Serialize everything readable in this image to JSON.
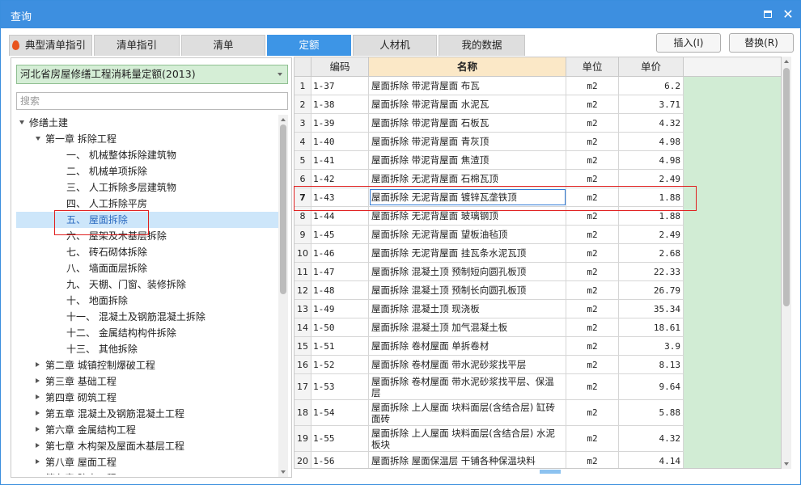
{
  "window": {
    "title": "查询"
  },
  "tabs": [
    {
      "label": "典型清单指引",
      "active": false
    },
    {
      "label": "清单指引",
      "active": false
    },
    {
      "label": "清单",
      "active": false
    },
    {
      "label": "定额",
      "active": true
    },
    {
      "label": "人材机",
      "active": false
    },
    {
      "label": "我的数据",
      "active": false
    }
  ],
  "buttons": {
    "insert": "插入(I)",
    "replace": "替换(R)"
  },
  "left": {
    "library": "河北省房屋修缮工程消耗量定额(2013)",
    "search_placeholder": "搜索",
    "tree": [
      {
        "label": "修缮土建",
        "level": 0,
        "expander": "down"
      },
      {
        "label": "第一章 拆除工程",
        "level": 1,
        "expander": "down"
      },
      {
        "label": "一、 机械整体拆除建筑物",
        "level": 2,
        "expander": ""
      },
      {
        "label": "二、 机械单项拆除",
        "level": 2,
        "expander": ""
      },
      {
        "label": "三、 人工拆除多层建筑物",
        "level": 2,
        "expander": ""
      },
      {
        "label": "四、 人工拆除平房",
        "level": 2,
        "expander": ""
      },
      {
        "label": "五、 屋面拆除",
        "level": 2,
        "expander": "",
        "selected": true
      },
      {
        "label": "六、 屋架及木基层拆除",
        "level": 2,
        "expander": ""
      },
      {
        "label": "七、 砖石砌体拆除",
        "level": 2,
        "expander": ""
      },
      {
        "label": "八、 墙面面层拆除",
        "level": 2,
        "expander": ""
      },
      {
        "label": "九、 天棚、门窗、装修拆除",
        "level": 2,
        "expander": ""
      },
      {
        "label": "十、 地面拆除",
        "level": 2,
        "expander": ""
      },
      {
        "label": "十一、 混凝土及钢筋混凝土拆除",
        "level": 2,
        "expander": ""
      },
      {
        "label": "十二、 金属结构构件拆除",
        "level": 2,
        "expander": ""
      },
      {
        "label": "十三、 其他拆除",
        "level": 2,
        "expander": ""
      },
      {
        "label": "第二章 城镇控制爆破工程",
        "level": 1,
        "expander": "right"
      },
      {
        "label": "第三章 基础工程",
        "level": 1,
        "expander": "right"
      },
      {
        "label": "第四章 砌筑工程",
        "level": 1,
        "expander": "right"
      },
      {
        "label": "第五章 混凝土及钢筋混凝土工程",
        "level": 1,
        "expander": "right"
      },
      {
        "label": "第六章 金属结构工程",
        "level": 1,
        "expander": "right"
      },
      {
        "label": "第七章 木构架及屋面木基层工程",
        "level": 1,
        "expander": "right"
      },
      {
        "label": "第八章 屋面工程",
        "level": 1,
        "expander": "right"
      },
      {
        "label": "第九章 防水工程",
        "level": 1,
        "expander": "right"
      }
    ]
  },
  "table": {
    "columns": {
      "code": "编码",
      "name": "名称",
      "unit": "单位",
      "price": "单价"
    },
    "current_row": 7,
    "rows": [
      {
        "no": "1",
        "code": "1-37",
        "name": "屋面拆除 带泥背屋面 布瓦",
        "unit": "m2",
        "price": "6.2"
      },
      {
        "no": "2",
        "code": "1-38",
        "name": "屋面拆除 带泥背屋面 水泥瓦",
        "unit": "m2",
        "price": "3.71"
      },
      {
        "no": "3",
        "code": "1-39",
        "name": "屋面拆除 带泥背屋面 石板瓦",
        "unit": "m2",
        "price": "4.32"
      },
      {
        "no": "4",
        "code": "1-40",
        "name": "屋面拆除 带泥背屋面 青灰顶",
        "unit": "m2",
        "price": "4.98"
      },
      {
        "no": "5",
        "code": "1-41",
        "name": "屋面拆除 带泥背屋面 焦渣顶",
        "unit": "m2",
        "price": "4.98"
      },
      {
        "no": "6",
        "code": "1-42",
        "name": "屋面拆除 无泥背屋面 石棉瓦顶",
        "unit": "m2",
        "price": "2.49"
      },
      {
        "no": "7",
        "code": "1-43",
        "name": "屋面拆除 无泥背屋面 镀锌瓦垄铁顶",
        "unit": "m2",
        "price": "1.88"
      },
      {
        "no": "8",
        "code": "1-44",
        "name": "屋面拆除 无泥背屋面 玻璃钢顶",
        "unit": "m2",
        "price": "1.88"
      },
      {
        "no": "9",
        "code": "1-45",
        "name": "屋面拆除 无泥背屋面 望板油毡顶",
        "unit": "m2",
        "price": "2.49"
      },
      {
        "no": "10",
        "code": "1-46",
        "name": "屋面拆除 无泥背屋面 挂瓦条水泥瓦顶",
        "unit": "m2",
        "price": "2.68"
      },
      {
        "no": "11",
        "code": "1-47",
        "name": "屋面拆除 混凝土顶 预制短向圆孔板顶",
        "unit": "m2",
        "price": "22.33"
      },
      {
        "no": "12",
        "code": "1-48",
        "name": "屋面拆除 混凝土顶 预制长向圆孔板顶",
        "unit": "m2",
        "price": "26.79"
      },
      {
        "no": "13",
        "code": "1-49",
        "name": "屋面拆除 混凝土顶 现浇板",
        "unit": "m2",
        "price": "35.34"
      },
      {
        "no": "14",
        "code": "1-50",
        "name": "屋面拆除 混凝土顶 加气混凝土板",
        "unit": "m2",
        "price": "18.61"
      },
      {
        "no": "15",
        "code": "1-51",
        "name": "屋面拆除 卷材屋面 单拆卷材",
        "unit": "m2",
        "price": "3.9"
      },
      {
        "no": "16",
        "code": "1-52",
        "name": "屋面拆除 卷材屋面 带水泥砂浆找平层",
        "unit": "m2",
        "price": "8.13"
      },
      {
        "no": "17",
        "code": "1-53",
        "name": "屋面拆除 卷材屋面 带水泥砂浆找平层、保温层",
        "unit": "m2",
        "price": "9.64"
      },
      {
        "no": "18",
        "code": "1-54",
        "name": "屋面拆除 上人屋面 块料面层(含结合层) 缸砖面砖",
        "unit": "m2",
        "price": "5.88"
      },
      {
        "no": "19",
        "code": "1-55",
        "name": "屋面拆除 上人屋面 块料面层(含结合层) 水泥板块",
        "unit": "m2",
        "price": "4.32"
      },
      {
        "no": "20",
        "code": "1-56",
        "name": "屋面拆除 屋面保温层 干铺各种保温块料",
        "unit": "m2",
        "price": "4.14"
      }
    ]
  }
}
